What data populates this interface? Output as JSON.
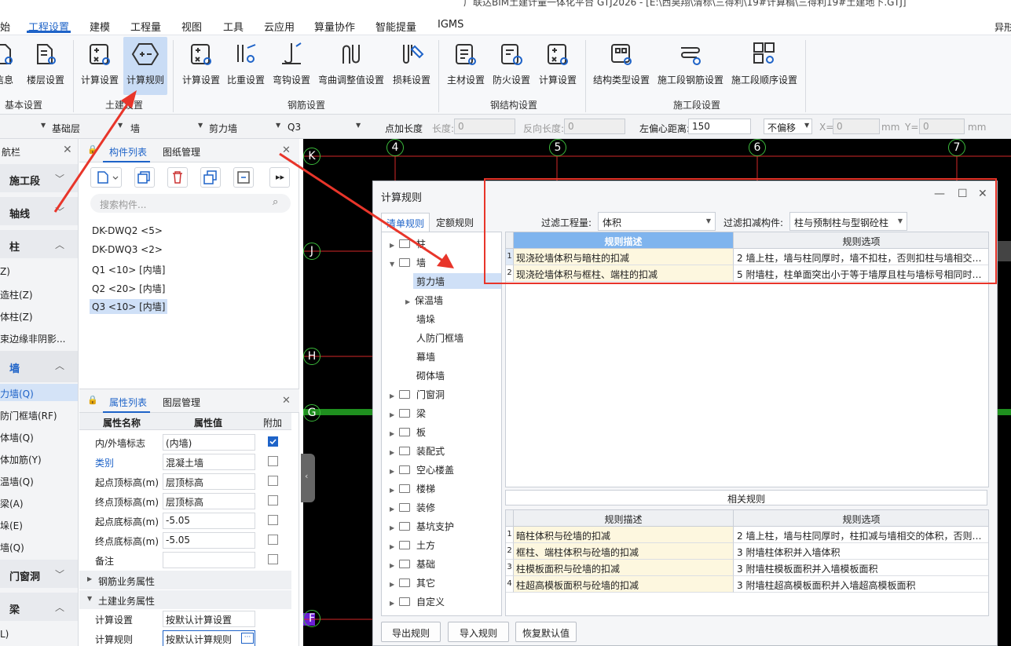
{
  "app": {
    "title": "广联达BIM土建计量一体化平台 GTJ2026 - [E:\\西昊翔\\清标\\三得利\\19#计算稿\\三得利19#土建地下.GTJ]"
  },
  "menu": {
    "items": [
      "始",
      "工程设置",
      "建模",
      "工程量",
      "视图",
      "工具",
      "云应用",
      "算量协作",
      "智能提量",
      "IGMS"
    ],
    "right": "异形"
  },
  "ribbon": {
    "groups": [
      {
        "label": "基本设置",
        "buttons": [
          "信息",
          "楼层设置"
        ]
      },
      {
        "label": "土建设置",
        "buttons": [
          "计算设置",
          "计算规则"
        ]
      },
      {
        "label": "钢筋设置",
        "buttons": [
          "计算设置",
          "比重设置",
          "弯钩设置",
          "弯曲调整值设置",
          "损耗设置"
        ]
      },
      {
        "label": "钢结构设置",
        "buttons": [
          "主材设置",
          "防火设置",
          "计算设置"
        ]
      },
      {
        "label": "施工段设置",
        "buttons": [
          "结构类型设置",
          "施工段钢筋设置",
          "施工段顺序设置"
        ]
      }
    ]
  },
  "toolbar": {
    "floor": "基础层",
    "category": "墙",
    "type": "剪力墙",
    "element": "Q3",
    "point_length": "点加长度",
    "length_label": "长度:",
    "length_value": "0",
    "reverse_label": "反向长度:",
    "reverse_value": "0",
    "offset_label": "左偏心距离:",
    "offset_value": "150",
    "no_offset": "不偏移",
    "x_label": "X=",
    "x_value": "0",
    "y_label": "Y=",
    "y_value": "0",
    "unit": "mm"
  },
  "leftnav": {
    "title": "航栏",
    "sections": {
      "shigongduan": "施工段",
      "zhouxian": "轴线",
      "zhu": "柱",
      "qiang": "墙",
      "menchuangdong": "门窗洞",
      "liang": "梁"
    },
    "zhu_items": [
      "Z)",
      "造柱(Z)",
      "体柱(Z)",
      "束边缘非阴影..."
    ],
    "qiang_items": [
      "力墙(Q)",
      "防门框墙(RF)",
      "体墙(Q)",
      "体加筋(Y)",
      "温墙(Q)",
      "梁(A)",
      "垛(E)",
      "墙(Q)"
    ],
    "liang_items": [
      "L)"
    ]
  },
  "component_list": {
    "tabs": [
      "构件列表",
      "图纸管理"
    ],
    "search_placeholder": "搜索构件...",
    "items": [
      "DK-DWQ2 <5>",
      "DK-DWQ3 <2>",
      "Q1 <10> [内墙]",
      "Q2 <20> [内墙]",
      "Q3 <10> [内墙]"
    ],
    "selected_index": 4
  },
  "properties": {
    "tabs": [
      "属性列表",
      "图层管理"
    ],
    "headers": [
      "属性名称",
      "属性值",
      "附加"
    ],
    "rows": [
      {
        "name": "内/外墙标志",
        "value": "(内墙)",
        "checked": true
      },
      {
        "name": "类别",
        "value": "混凝土墙",
        "checked": false
      },
      {
        "name": "起点顶标高(m)",
        "value": "层顶标高",
        "checked": false
      },
      {
        "name": "终点顶标高(m)",
        "value": "层顶标高",
        "checked": false
      },
      {
        "name": "起点底标高(m)",
        "value": "-5.05",
        "checked": false
      },
      {
        "name": "终点底标高(m)",
        "value": "-5.05",
        "checked": false
      },
      {
        "name": "备注",
        "value": "",
        "checked": false
      }
    ],
    "sections": [
      "钢筋业务属性",
      "土建业务属性"
    ],
    "civil_rows": [
      {
        "name": "计算设置",
        "value": "按默认计算设置"
      },
      {
        "name": "计算规则",
        "value": "按默认计算规则"
      }
    ]
  },
  "canvas": {
    "axes_top": [
      "4",
      "5",
      "6",
      "7"
    ],
    "axes_left": [
      "K",
      "J",
      "H",
      "G",
      "F"
    ],
    "colors": {
      "background": "#000000",
      "axis": "#d42828",
      "circle": "#3cbc3c"
    }
  },
  "dialog": {
    "title": "计算规则",
    "tabs": [
      "清单规则",
      "定额规则"
    ],
    "filter_qty_label": "过滤工程量:",
    "filter_qty_value": "体积",
    "filter_deduct_label": "过滤扣减构件:",
    "filter_deduct_value": "柱与预制柱与型钢砼柱",
    "tree": [
      {
        "label": "柱",
        "expanded": false,
        "level": 0
      },
      {
        "label": "墙",
        "expanded": true,
        "level": 0
      },
      {
        "label": "剪力墙",
        "level": 1,
        "selected": true
      },
      {
        "label": "保温墙",
        "level": 1,
        "hasChildren": true
      },
      {
        "label": "墙垛",
        "level": 1
      },
      {
        "label": "人防门框墙",
        "level": 1
      },
      {
        "label": "幕墙",
        "level": 1
      },
      {
        "label": "砌体墙",
        "level": 1
      },
      {
        "label": "门窗洞",
        "level": 0
      },
      {
        "label": "梁",
        "level": 0
      },
      {
        "label": "板",
        "level": 0
      },
      {
        "label": "装配式",
        "level": 0
      },
      {
        "label": "空心楼盖",
        "level": 0
      },
      {
        "label": "楼梯",
        "level": 0
      },
      {
        "label": "装修",
        "level": 0
      },
      {
        "label": "基坑支护",
        "level": 0
      },
      {
        "label": "土方",
        "level": 0
      },
      {
        "label": "基础",
        "level": 0
      },
      {
        "label": "其它",
        "level": 0
      },
      {
        "label": "自定义",
        "level": 0
      }
    ],
    "rules_headers": [
      "规则描述",
      "规则选项"
    ],
    "rules": [
      {
        "num": "1",
        "desc": "现浇砼墙体积与暗柱的扣减",
        "option": "2   墙上柱，墙与柱同厚时，墙不扣柱，否则扣柱与墙相交…"
      },
      {
        "num": "2",
        "desc": "现浇砼墙体积与框柱、端柱的扣减",
        "option": "5   附墙柱，柱单面突出小于等于墙厚且柱与墙标号相同时…"
      }
    ],
    "related_title": "相关规则",
    "related_headers": [
      "规则描述",
      "规则选项"
    ],
    "related_rules": [
      {
        "num": "1",
        "desc": "暗柱体积与砼墙的扣减",
        "option": "2 墙上柱，墙与柱同厚时，柱扣减与墙相交的体积，否则…"
      },
      {
        "num": "2",
        "desc": "框柱、端柱体积与砼墙的扣减",
        "option": "3 附墙柱体积并入墙体积"
      },
      {
        "num": "3",
        "desc": "柱模板面积与砼墙的扣减",
        "option": "3 附墙柱模板面积并入墙模板面积"
      },
      {
        "num": "4",
        "desc": "柱超高模板面积与砼墙的扣减",
        "option": "3 附墙柱超高模板面积并入墙超高模板面积"
      }
    ],
    "buttons": [
      "导出规则",
      "导入规则",
      "恢复默认值"
    ]
  },
  "annotation": {
    "arrow_color": "#e8352a",
    "box_color": "#e8352a"
  }
}
